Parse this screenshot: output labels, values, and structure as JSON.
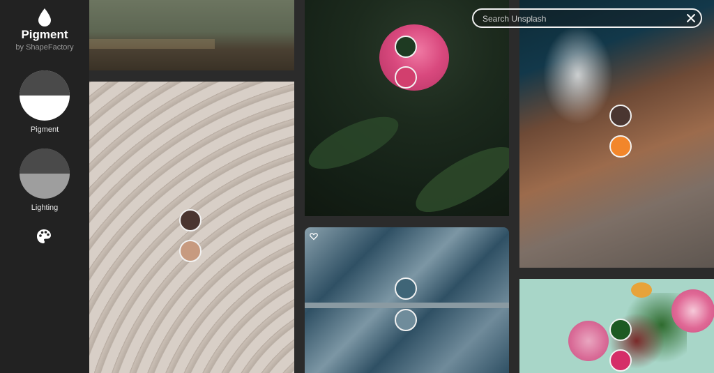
{
  "app": {
    "title": "Pigment",
    "subtitle": "by ShapeFactory"
  },
  "sidebar": {
    "modes": [
      {
        "label": "Pigment",
        "icon": "pigment-mode-icon"
      },
      {
        "label": "Lighting",
        "icon": "lighting-mode-icon"
      }
    ],
    "palette_icon": "palette-icon"
  },
  "search": {
    "placeholder": "Search Unsplash",
    "value": ""
  },
  "photos": [
    {
      "name": "wall-photo",
      "swatches": []
    },
    {
      "name": "amphitheater-photo",
      "swatches": [
        "#4a3530",
        "#c79a7f"
      ]
    },
    {
      "name": "peony-photo",
      "swatches": [
        "#1e3a22",
        "#d23f6e"
      ]
    },
    {
      "name": "river-photo",
      "swatches": [
        "#3f6577",
        "#6f8c9b"
      ]
    },
    {
      "name": "coast-photo",
      "swatches": [
        "#4a3631",
        "#f2862b"
      ]
    },
    {
      "name": "flowers-photo",
      "swatches": [
        "#1d5a22",
        "#d52d68"
      ]
    }
  ],
  "colors": {
    "sidebar_bg": "#222222",
    "page_bg": "#2b2b2b",
    "accent_white": "#ffffff"
  }
}
